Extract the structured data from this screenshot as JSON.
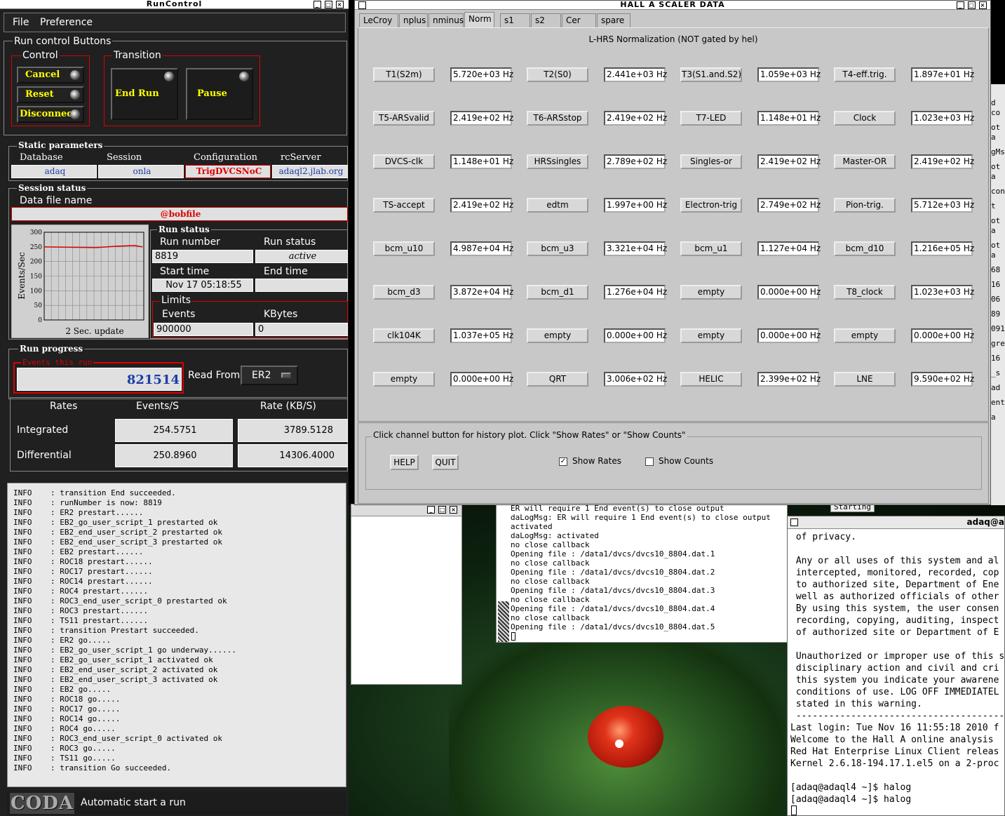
{
  "runcontrol": {
    "title": "RunControl",
    "menu": [
      "File",
      "Preference"
    ],
    "run_control_buttons_label": "Run control Buttons",
    "control_label": "Control",
    "transition_label": "Transition",
    "control_buttons": [
      "Cancel",
      "Reset",
      "Disconnect"
    ],
    "transition_buttons": [
      "End Run",
      "Pause"
    ],
    "static_params_label": "Static parameters",
    "params": [
      {
        "label": "Database",
        "value": "adaq"
      },
      {
        "label": "Session",
        "value": "onla"
      },
      {
        "label": "Configuration",
        "value": "TrigDVCSNoC"
      },
      {
        "label": "rcServer",
        "value": "adaql2.jlab.org"
      }
    ],
    "session_status_label": "Session status",
    "data_file_label": "Data file name",
    "data_file": "@bobfile",
    "graph": {
      "ylabel": "Events/Sec",
      "xlabel": "2 Sec. update",
      "yticks": [
        "300",
        "250",
        "200",
        "150",
        "100",
        "50",
        "0"
      ],
      "ymax": 300,
      "level": 250
    },
    "run_status_label": "Run status",
    "run_number_label": "Run number",
    "run_number": "8819",
    "run_status_field_label": "Run status",
    "run_status": "active",
    "start_time_label": "Start time",
    "start_time": "Nov 17 05:18:55",
    "end_time_label": "End time",
    "end_time": "",
    "limits_label": "Limits",
    "events_label": "Events",
    "events": "900000",
    "kbytes_label": "KBytes",
    "kbytes": "0",
    "run_progress_label": "Run progress",
    "events_this_run_label": "Events this run",
    "events_this_run": "821514",
    "read_from_label": "Read From:",
    "read_from": "ER2",
    "rates_head": [
      "Rates",
      "Events/S",
      "Rate (KB/S)"
    ],
    "integrated_label": "Integrated",
    "integrated_events": "254.5751",
    "integrated_rate": "3789.5128",
    "differential_label": "Differential",
    "differential_events": "250.8960",
    "differential_rate": "14306.4000",
    "log": "INFO    : transition End succeeded.\nINFO    : runNumber is now: 8819\nINFO    : ER2 prestart......\nINFO    : EB2_go_user_script_1 prestarted ok\nINFO    : EB2_end_user_script_2 prestarted ok\nINFO    : EB2_end_user_script_3 prestarted ok\nINFO    : EB2 prestart......\nINFO    : ROC18 prestart......\nINFO    : ROC17 prestart......\nINFO    : ROC14 prestart......\nINFO    : ROC4 prestart......\nINFO    : ROC3_end_user_script_0 prestarted ok\nINFO    : ROC3 prestart......\nINFO    : TS11 prestart......\nINFO    : transition Prestart succeeded.\nINFO    : ER2 go.....\nINFO    : EB2_go_user_script_1 go underway......\nINFO    : EB2_go_user_script_1 activated ok\nINFO    : EB2_end_user_script_2 activated ok\nINFO    : EB2_end_user_script_3 activated ok\nINFO    : EB2 go.....\nINFO    : ROC18 go.....\nINFO    : ROC17 go.....\nINFO    : ROC14 go.....\nINFO    : ROC4 go.....\nINFO    : ROC3_end_user_script_0 activated ok\nINFO    : ROC3 go.....\nINFO    : TS11 go.....\nINFO    : transition Go succeeded.",
    "coda_logo": "CODA",
    "status_bar": "Automatic start a run"
  },
  "scaler": {
    "title": "HALL  A  SCALER  DATA",
    "tabs": [
      "LeCroy",
      "nplus",
      "nminus",
      "Norm",
      "s1",
      "s2",
      "Cer",
      "spare"
    ],
    "active_tab": "Norm",
    "heading": "L-HRS Normalization (NOT gated by hel)",
    "rows": [
      [
        [
          "T1(S2m)",
          "5.720e+03 Hz"
        ],
        [
          "T2(S0)",
          "2.441e+03 Hz"
        ],
        [
          "T3(S1.and.S2)",
          "1.059e+03 Hz"
        ],
        [
          "T4-eff.trig.",
          "1.897e+01 Hz"
        ]
      ],
      [
        [
          "T5-ARSvalid",
          "2.419e+02 Hz"
        ],
        [
          "T6-ARSstop",
          "2.419e+02 Hz"
        ],
        [
          "T7-LED",
          "1.148e+01 Hz"
        ],
        [
          "Clock",
          "1.023e+03 Hz"
        ]
      ],
      [
        [
          "DVCS-clk",
          "1.148e+01 Hz"
        ],
        [
          "HRSsingles",
          "2.789e+02 Hz"
        ],
        [
          "Singles-or",
          "2.419e+02 Hz"
        ],
        [
          "Master-OR",
          "2.419e+02 Hz"
        ]
      ],
      [
        [
          "TS-accept",
          "2.419e+02 Hz"
        ],
        [
          "edtm",
          "1.997e+00 Hz"
        ],
        [
          "Electron-trig",
          "2.749e+02 Hz"
        ],
        [
          "Pion-trig.",
          "5.712e+03 Hz"
        ]
      ],
      [
        [
          "bcm_u10",
          "4.987e+04 Hz"
        ],
        [
          "bcm_u3",
          "3.321e+04 Hz"
        ],
        [
          "bcm_u1",
          "1.127e+04 Hz"
        ],
        [
          "bcm_d10",
          "1.216e+05 Hz"
        ]
      ],
      [
        [
          "bcm_d3",
          "3.872e+04 Hz"
        ],
        [
          "bcm_d1",
          "1.276e+04 Hz"
        ],
        [
          "empty",
          "0.000e+00 Hz"
        ],
        [
          "T8_clock",
          "1.023e+03 Hz"
        ]
      ],
      [
        [
          "clk104K",
          "1.037e+05 Hz"
        ],
        [
          "empty",
          "0.000e+00 Hz"
        ],
        [
          "empty",
          "0.000e+00 Hz"
        ],
        [
          "empty",
          "0.000e+00 Hz"
        ]
      ],
      [
        [
          "empty",
          "0.000e+00 Hz"
        ],
        [
          "QRT",
          "3.006e+02 Hz"
        ],
        [
          "HELIC",
          "2.399e+02 Hz"
        ],
        [
          "LNE",
          "9.590e+02 Hz"
        ]
      ]
    ],
    "hint": "Click channel button for history plot.  Click \"Show Rates\" or \"Show Counts\"",
    "help_label": "HELP",
    "quit_label": "QUIT",
    "show_rates_label": "Show Rates",
    "show_counts_label": "Show Counts",
    "show_rates_checked": true,
    "show_counts_checked": false
  },
  "daq_terminal": {
    "text": "ER will require 1 End event(s) to close output\ndaLogMsg: ER will require 1 End event(s) to close output\nactivated\ndaLogMsg: activated\nno close callback\nOpening file : /data1/dvcs/dvcs10_8804.dat.1\nno close callback\nOpening file : /data1/dvcs/dvcs10_8804.dat.2\nno close callback\nOpening file : /data1/dvcs/dvcs10_8804.dat.3\nno close callback\nOpening file : /data1/dvcs/dvcs10_8804.dat.4\nno close callback\nOpening file : /data1/dvcs/dvcs10_8804.dat.5",
    "behind_label": "Starting"
  },
  "ssh_terminal": {
    "title": "adaq@a",
    "text": " of privacy.\n\n Any or all uses of this system and al\n intercepted, monitored, recorded, cop\n to authorized site, Department of Ene\n well as authorized officials of other\n By using this system, the user consen\n recording, copying, auditing, inspect\n of authorized site or Department of E\n\n Unauthorized or improper use of this s\n disciplinary action and civil and cri\n this system you indicate your awarene\n conditions of use. LOG OFF IMMEDIATEL\n stated in this warning.\n --------------------------------------\nLast login: Tue Nov 16 11:55:18 2010 f\nWelcome to the Hall A online analysis \nRed Hat Enterprise Linux Client releas\nKernel 2.6.18-194.17.1.el5 on a 2-proc\n\n[adaq@adaql4 ~]$ halog\n[adaq@adaql4 ~]$ halog\n"
  },
  "right_edge_text": [
    "d co",
    "ot a",
    "gMsg",
    "ot a",
    "cont",
    "t",
    "ot a",
    "ot a",
    "68",
    "16",
    "06",
    "89",
    "091",
    "gre",
    "16",
    "_s",
    "ad",
    "ent",
    "a"
  ],
  "colors": {
    "red": "#dd0000",
    "yellow": "#ffff00",
    "blue": "#1a3ea8",
    "panel": "#c8c8c8",
    "dark": "#202020"
  }
}
